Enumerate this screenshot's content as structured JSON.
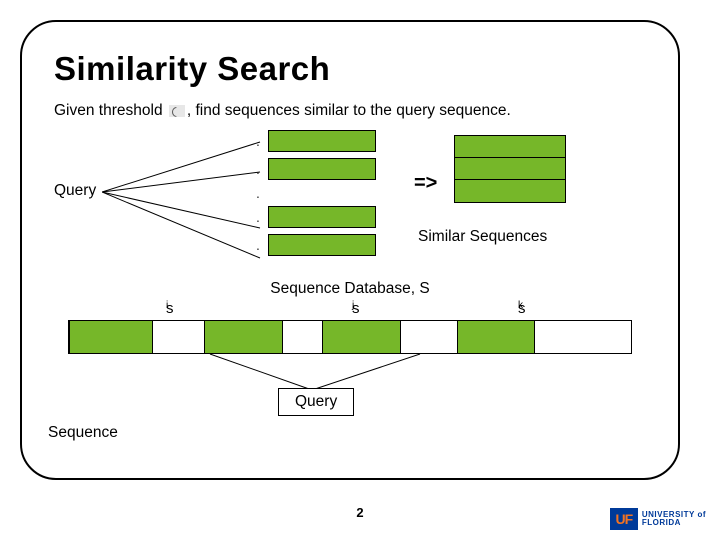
{
  "title": "Similarity Search",
  "intro_prefix": "Given threshold",
  "intro_suffix": ", find sequences similar to the query sequence.",
  "query_label": "Query",
  "arrow": "=>",
  "similar_label": "Similar Sequences",
  "db_label": "Sequence Database, S",
  "sub_i_base": "s",
  "sub_i_sub": "i",
  "sub_j_base": "s",
  "sub_j_sub": "j",
  "sub_k_base": "s",
  "sub_k_sub": "k",
  "sequence_label": "Sequence",
  "query_box": "Query",
  "page_num": "2",
  "logo_uf": "UF",
  "logo_text1": "UNIVERSITY of",
  "logo_text2": "FLORIDA"
}
